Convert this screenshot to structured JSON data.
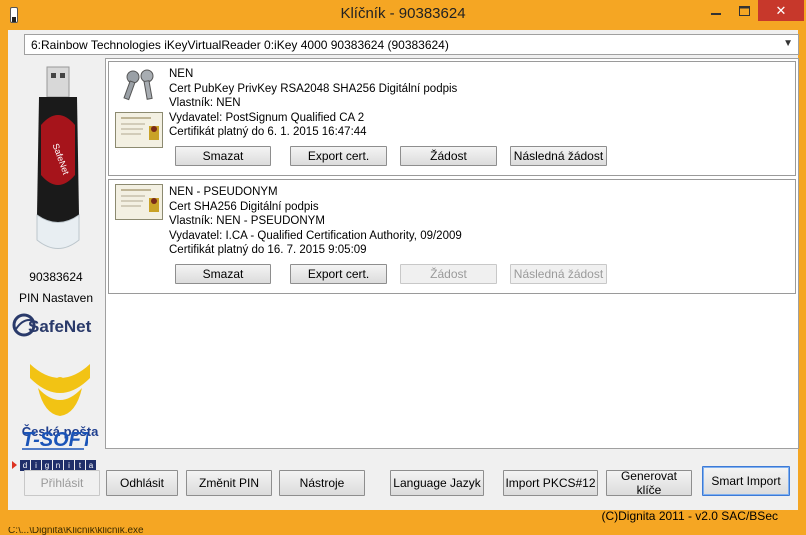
{
  "window": {
    "title": "Klíčník - 90383624",
    "minimize_icon": "minimize-icon",
    "maximize_icon": "maximize-icon",
    "close_label": "✕"
  },
  "reader": {
    "selected": "6:Rainbow Technologies iKeyVirtualReader 0:iKey 4000 90383624 (90383624)"
  },
  "token": {
    "serial": "90383624",
    "pin_status": "PIN Nastaven"
  },
  "logos": {
    "safenet": "SafeNet",
    "posta": "Česká pošta",
    "tsoft": "T-SOFT",
    "dignita": [
      "d",
      "i",
      "g",
      "n",
      "i",
      "t",
      "a"
    ]
  },
  "certificates": [
    {
      "name": "NEN",
      "line2": "Cert PubKey PrivKey  RSA2048 SHA256  Digitální podpis",
      "owner": "Vlastník: NEN",
      "issuer": "Vydavatel: PostSignum Qualified CA 2",
      "validity": "Certifikát platný do 6. 1. 2015 16:47:44",
      "has_keys": true,
      "buttons": [
        {
          "label": "Smazat",
          "enabled": true
        },
        {
          "label": "Export cert.",
          "enabled": true
        },
        {
          "label": "Žádost",
          "enabled": true
        },
        {
          "label": "Následná žádost",
          "enabled": true
        }
      ]
    },
    {
      "name": "NEN - PSEUDONYM",
      "line2": "Cert   SHA256  Digitální podpis",
      "owner": "Vlastník: NEN - PSEUDONYM",
      "issuer": "Vydavatel: I.CA - Qualified Certification Authority, 09/2009",
      "validity": "Certifikát platný do 16. 7. 2015 9:05:09",
      "has_keys": false,
      "buttons": [
        {
          "label": "Smazat",
          "enabled": true
        },
        {
          "label": "Export cert.",
          "enabled": true
        },
        {
          "label": "Žádost",
          "enabled": false
        },
        {
          "label": "Následná žádost",
          "enabled": false
        }
      ]
    }
  ],
  "bottom_buttons": {
    "login": "Přihlásit",
    "logout": "Odhlásit",
    "change_pin": "Změnit PIN",
    "tools": "Nástroje",
    "language": "Language Jazyk",
    "import_pkcs12": "Import PKCS#12",
    "generate_keys": "Generovat klíče",
    "smart_import": "Smart Import"
  },
  "footer": "(C)Dignita 2011 - v2.0 SAC/BSec",
  "below_window_text": "C:\\...\\Dignita\\Klicnik\\klicnik.exe"
}
